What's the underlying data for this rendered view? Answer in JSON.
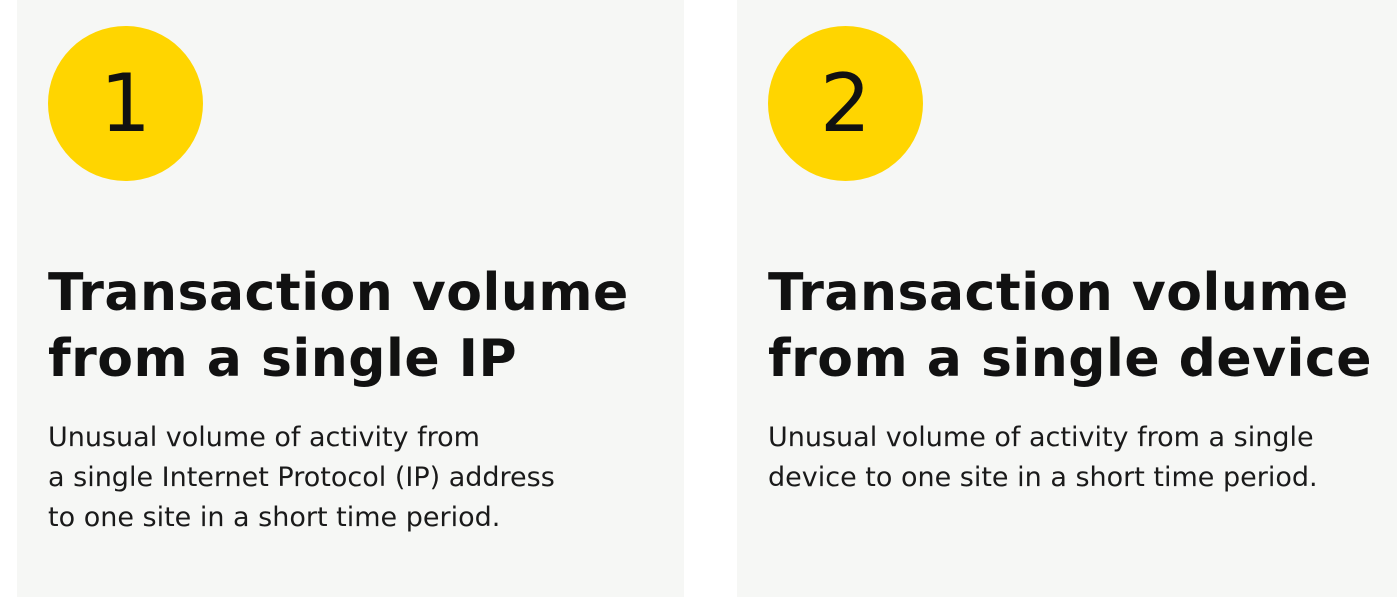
{
  "cards": [
    {
      "number": "1",
      "title_line1": "Transaction volume",
      "title_line2": "from a single IP",
      "description": "Unusual volume of activity from\na single Internet Protocol (IP) address\nto one site in a short time period."
    },
    {
      "number": "2",
      "title_line1": "Transaction volume",
      "title_line2": "from a single device",
      "description": "Unusual volume of activity from a single\ndevice to one site in a short time period."
    }
  ],
  "colors": {
    "badge": "#ffd500",
    "card_background": "#f6f7f5",
    "text": "#111111"
  }
}
